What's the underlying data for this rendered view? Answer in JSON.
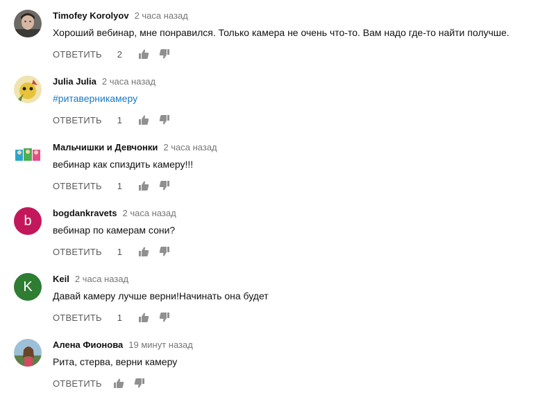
{
  "comments": [
    {
      "author": "Timofey Korolyov",
      "time": "2 часа назад",
      "text": "Хороший вебинар, мне понравился.  Только камера  не очень что-то. Вам надо где-то найти получше.",
      "likes": "2",
      "reply_label": "ОТВЕТИТЬ"
    },
    {
      "author": "Julia Julia",
      "time": "2 часа назад",
      "text": "#ритаверникамеру",
      "likes": "1",
      "reply_label": "ОТВЕТИТЬ"
    },
    {
      "author": "Мальчишки и Девчонки",
      "time": "2 часа назад",
      "text": "вебинар как спиздить камеру!!!",
      "likes": "1",
      "reply_label": "ОТВЕТИТЬ"
    },
    {
      "author": "bogdankravets",
      "time": "2 часа назад",
      "text": "вебинар по камерам сони?",
      "likes": "1",
      "reply_label": "ОТВЕТИТЬ",
      "avatar_letter": "b",
      "avatar_color": "#c2185b"
    },
    {
      "author": "Keil",
      "time": "2 часа назад",
      "text": "Давай камеру лучше верни!Начинать она будет",
      "likes": "1",
      "reply_label": "ОТВЕТИТЬ",
      "avatar_letter": "K",
      "avatar_color": "#2e7d32"
    },
    {
      "author": "Алена Фионова",
      "time": "19 минут назад",
      "text": "Рита, стерва, верни камеру",
      "likes": "",
      "reply_label": "ОТВЕТИТЬ"
    }
  ],
  "colors": {
    "link_blue": "#167ac6",
    "muted_gray": "#767676",
    "icon_gray": "#909090"
  },
  "icons": {
    "like": "thumbs-up-icon",
    "dislike": "thumbs-down-icon"
  }
}
